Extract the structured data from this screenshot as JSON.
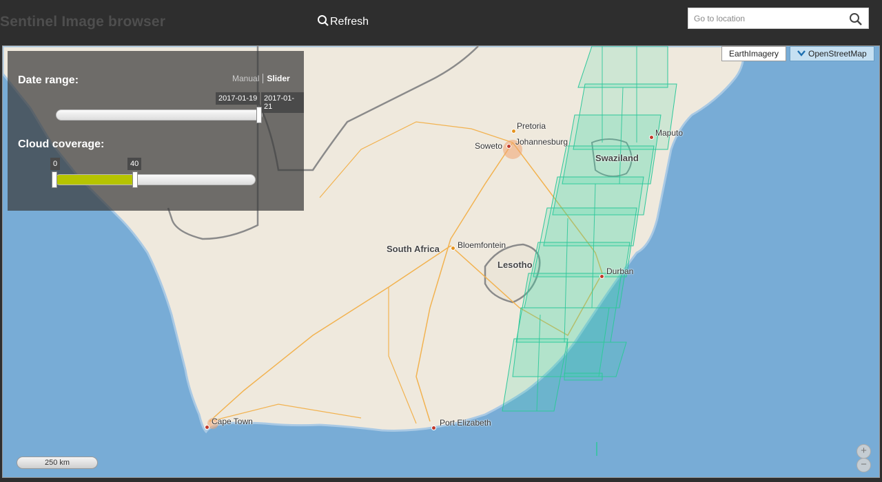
{
  "header": {
    "title": "Sentinel Image browser",
    "refresh_label": "Refresh",
    "search_placeholder": "Go to location"
  },
  "panel": {
    "date_range_label": "Date range:",
    "mode_manual": "Manual",
    "mode_slider": "Slider",
    "date_start": "2017-01-19",
    "date_end": "2017-01-21",
    "cloud_label": "Cloud coverage:",
    "cloud_min": "0",
    "cloud_max": "40",
    "cloud_max_fraction": 0.4
  },
  "layers": {
    "earth_imagery": "EarthImagery",
    "osm": "OpenStreetMap"
  },
  "map": {
    "scale_label": "250 km",
    "countries": [
      "South Africa",
      "Lesotho",
      "Swaziland"
    ],
    "cities": [
      "Pretoria",
      "Johannesburg",
      "Soweto",
      "Maputo",
      "Bloemfontein",
      "Durban",
      "Cape Town",
      "Port Elizabeth"
    ]
  },
  "zoom": {
    "in": "+",
    "out": "−"
  },
  "colors": {
    "header_bg": "#2e2e2e",
    "ocean": "#78acd6",
    "land": "#efe9dd",
    "footprint": "#35d6a8",
    "slider_fill": "#b6c400"
  }
}
